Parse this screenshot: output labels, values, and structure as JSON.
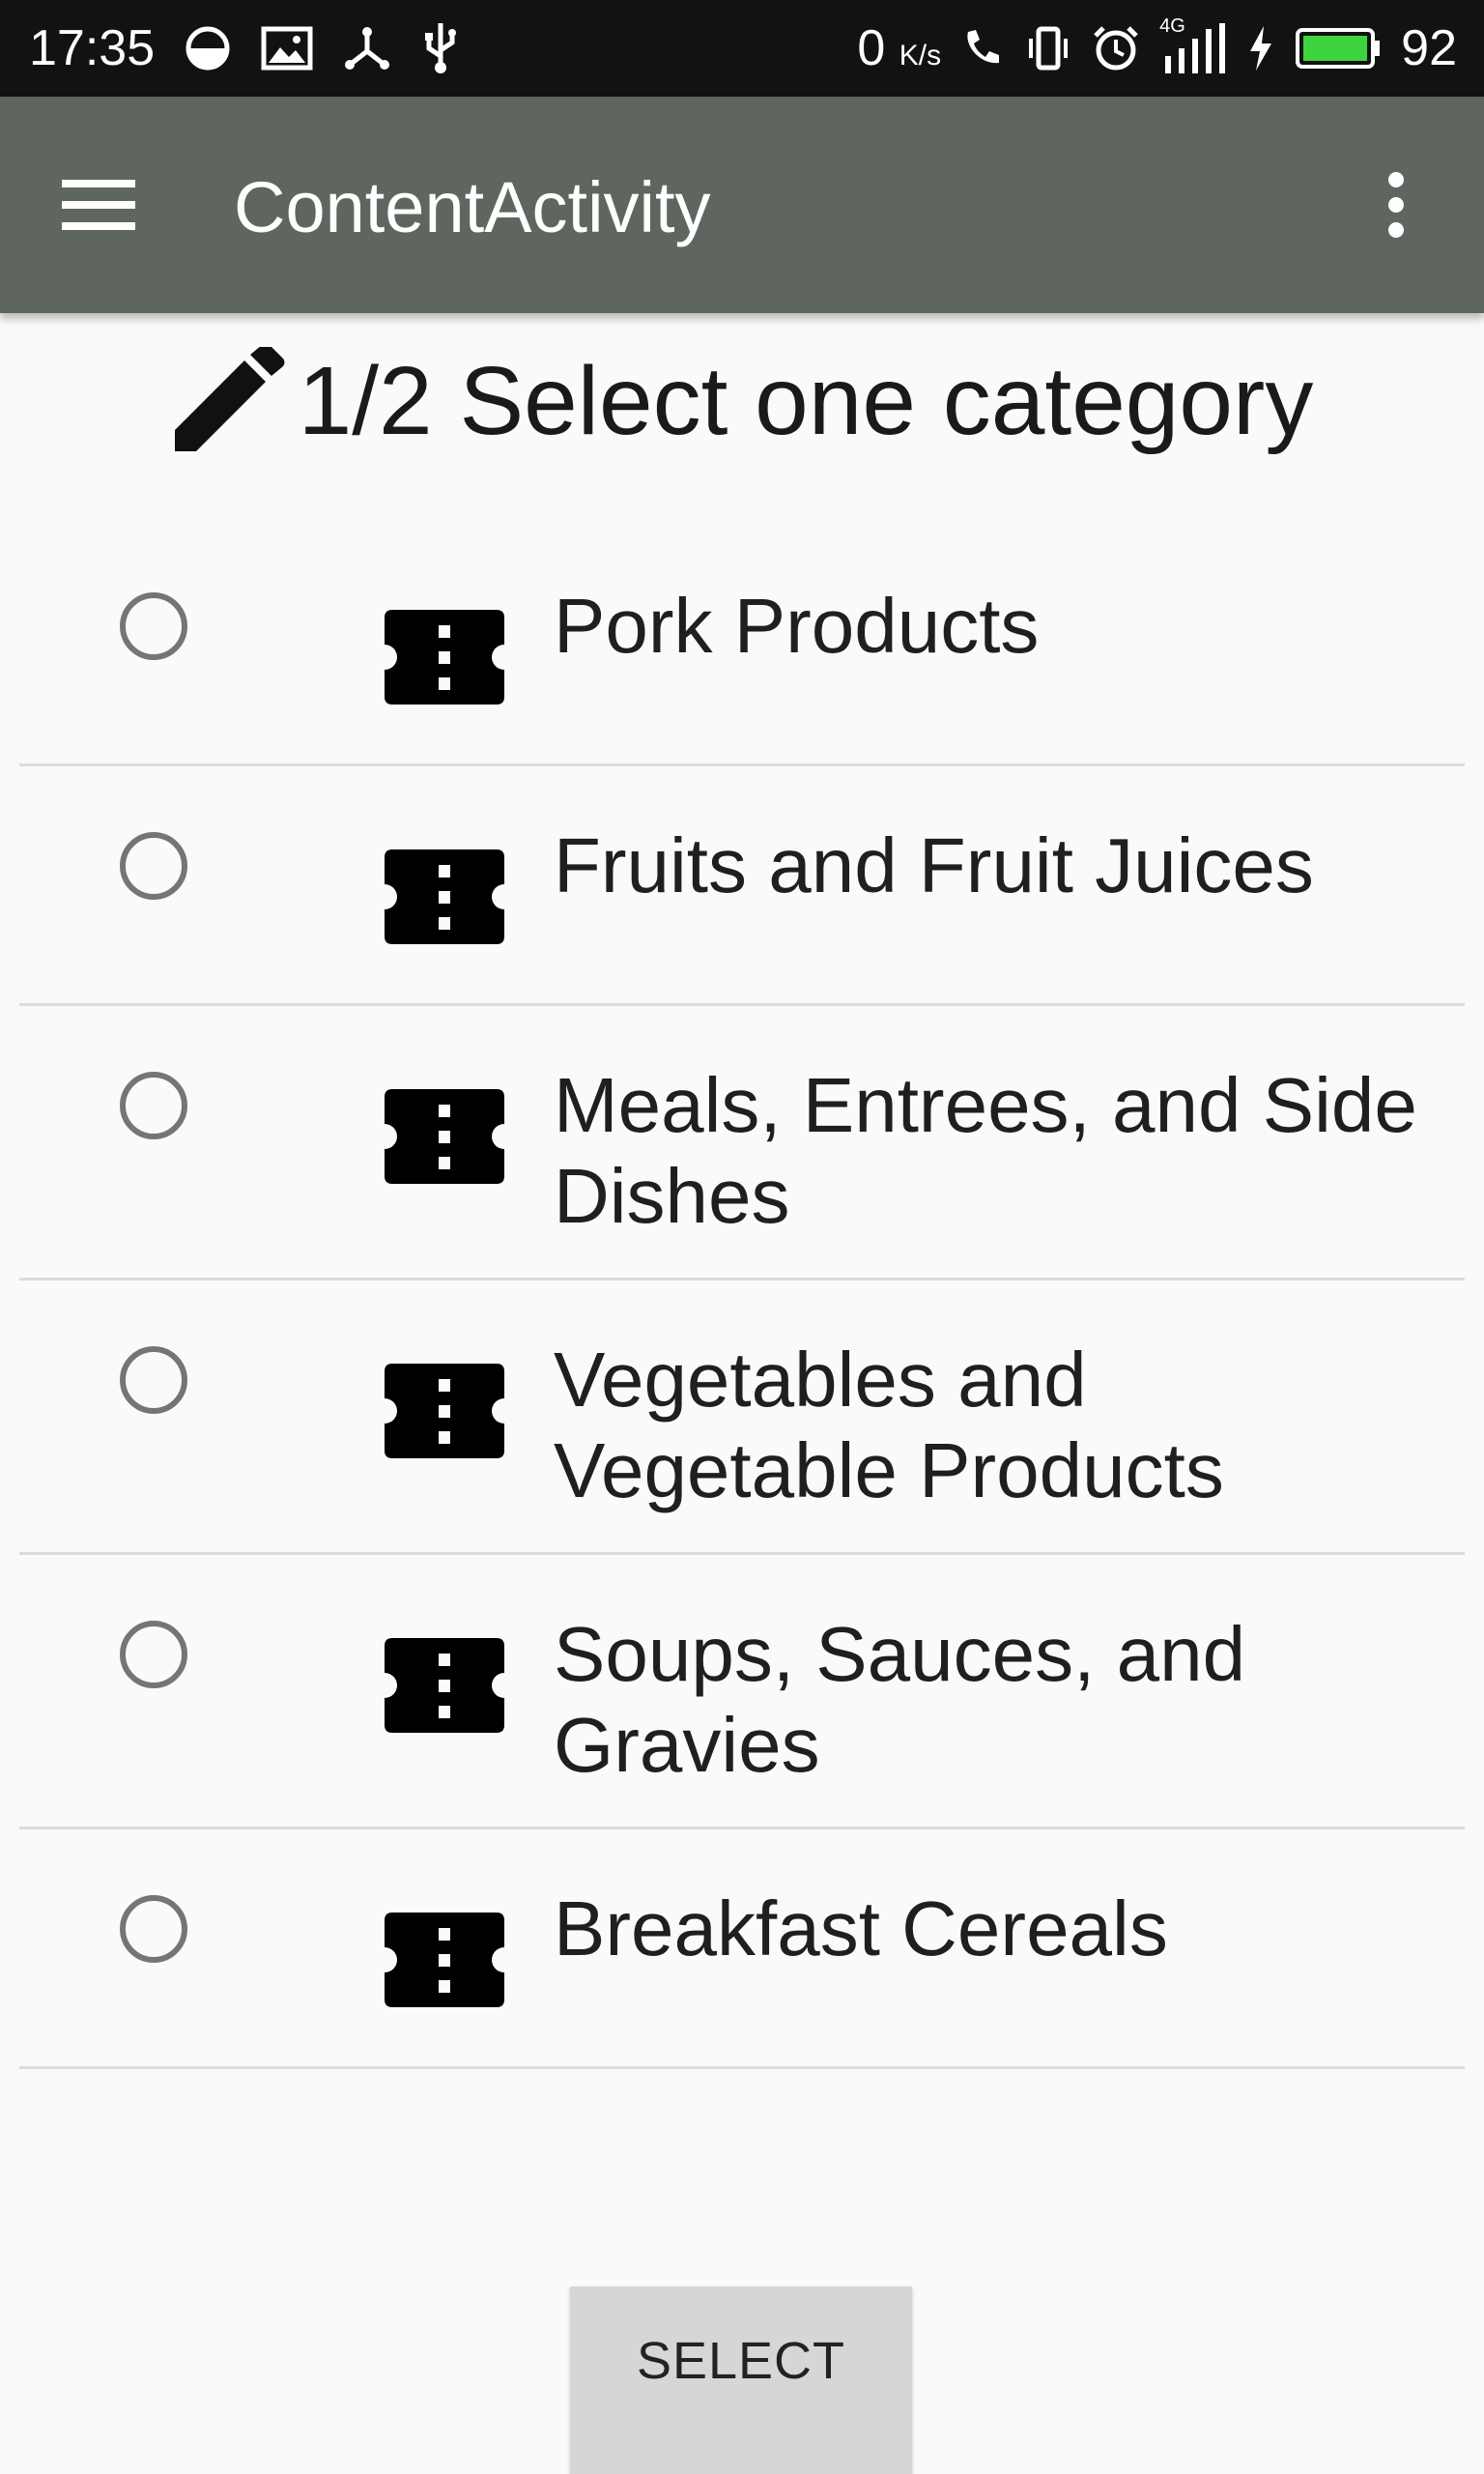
{
  "status_bar": {
    "time": "17:35",
    "network_speed": "0",
    "speed_unit": "K/s",
    "signal_label": "4G",
    "battery": "92",
    "icons": [
      "data-saver-icon",
      "image-icon",
      "share-icon",
      "usb-icon",
      "phone-icon",
      "vibrate-icon",
      "alarm-icon",
      "signal-icon",
      "charging-icon",
      "battery-icon"
    ]
  },
  "app_bar": {
    "title": "ContentActivity",
    "menu_icon": "hamburger-menu-icon",
    "overflow_icon": "more-vert-icon",
    "background": "#5f665f"
  },
  "heading": {
    "icon": "pencil-icon",
    "text": "1/2 Select one category"
  },
  "categories": [
    {
      "label": "Pork Products",
      "selected": false,
      "icon": "ticket-icon"
    },
    {
      "label": "Fruits and Fruit Juices",
      "selected": false,
      "icon": "ticket-icon"
    },
    {
      "label": "Meals, Entrees, and Side Dishes",
      "selected": false,
      "icon": "ticket-icon"
    },
    {
      "label": "Vegetables and Vegetable Products",
      "selected": false,
      "icon": "ticket-icon"
    },
    {
      "label": "Soups, Sauces, and Gravies",
      "selected": false,
      "icon": "ticket-icon"
    },
    {
      "label": "Breakfast Cereals",
      "selected": false,
      "icon": "ticket-icon"
    }
  ],
  "actions": {
    "select_label": "SELECT"
  }
}
